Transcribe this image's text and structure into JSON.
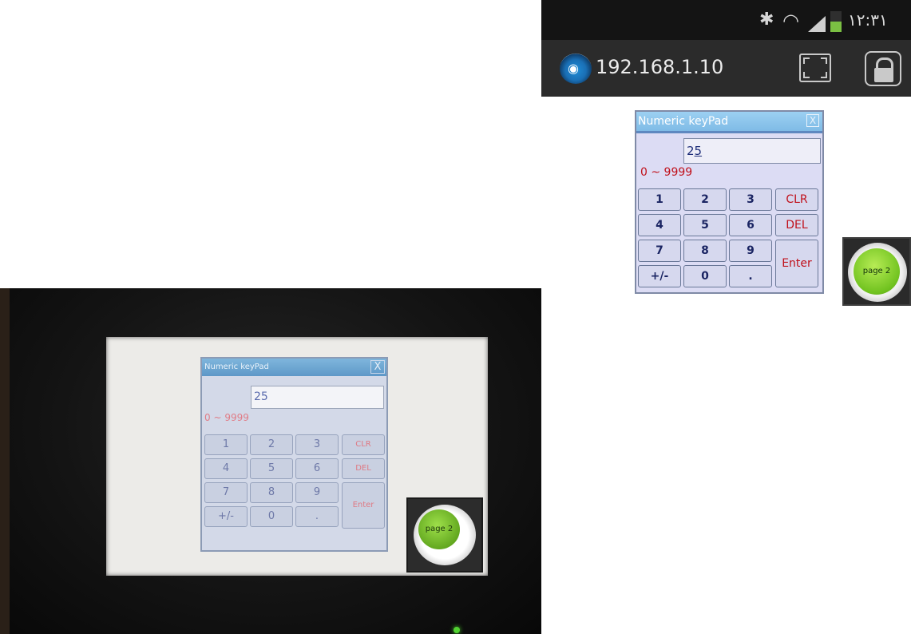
{
  "phone": {
    "status_bar": {
      "icons": [
        "bluetooth-icon",
        "wifi-signal-icon",
        "cell-signal-icon",
        "battery-icon"
      ],
      "clock": "١٢:٣١"
    },
    "app_bar": {
      "app_icon": "wifi-remote-icon",
      "host": "192.168.1.10",
      "actions": [
        "fullscreen-icon",
        "lock-icon"
      ]
    },
    "keypad": {
      "title": "Numeric keyPad",
      "close_label": "X",
      "value_prefix": "2",
      "value_underlined": "5",
      "range": "0 ~ 9999",
      "keys": {
        "k1": "1",
        "k2": "2",
        "k3": "3",
        "clr": "CLR",
        "k4": "4",
        "k5": "5",
        "k6": "6",
        "del": "DEL",
        "k7": "7",
        "k8": "8",
        "k9": "9",
        "enter": "Enter",
        "sign": "+/-",
        "k0": "0",
        "dot": "."
      }
    },
    "page_button": "page 2"
  },
  "panel_photo": {
    "keypad": {
      "title": "Numeric keyPad",
      "close_label": "X",
      "value": "25",
      "range": "0 ~ 9999",
      "keys": {
        "k1": "1",
        "k2": "2",
        "k3": "3",
        "clr": "CLR",
        "k4": "4",
        "k5": "5",
        "k6": "6",
        "del": "DEL",
        "k7": "7",
        "k8": "8",
        "k9": "9",
        "enter": "Enter",
        "sign": "+/-",
        "k0": "0",
        "dot": "."
      }
    },
    "page_button": "page 2"
  },
  "colors": {
    "keypad_title_bar": "#7fbbe6",
    "keypad_body": "#dcdcf4",
    "range_text": "#c0101a",
    "page_button_green": "#70c21f",
    "status_bar": "#141414",
    "app_bar": "#2b2b2b"
  }
}
